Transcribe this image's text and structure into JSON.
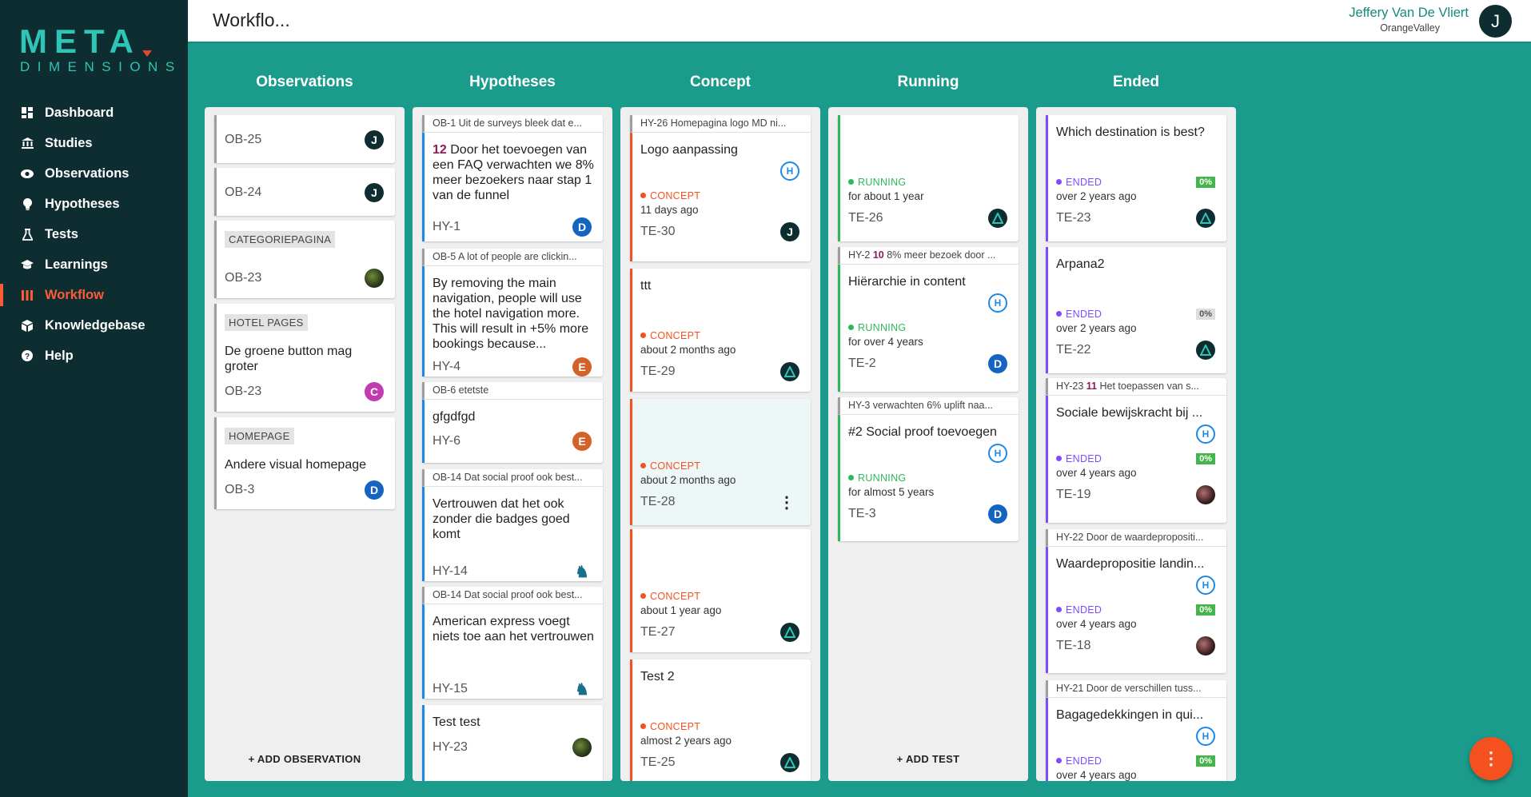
{
  "brand": {
    "name": "META",
    "sub": "DIMENSIONS"
  },
  "nav": [
    {
      "label": "Dashboard",
      "icon": "dashboard-icon"
    },
    {
      "label": "Studies",
      "icon": "bank-icon"
    },
    {
      "label": "Observations",
      "icon": "eye-icon"
    },
    {
      "label": "Hypotheses",
      "icon": "lightbulb-icon"
    },
    {
      "label": "Tests",
      "icon": "flask-icon"
    },
    {
      "label": "Learnings",
      "icon": "graduation-cap-icon"
    },
    {
      "label": "Workflow",
      "icon": "columns-icon",
      "active": true
    },
    {
      "label": "Knowledgebase",
      "icon": "box-icon"
    },
    {
      "label": "Help",
      "icon": "help-circle-icon"
    }
  ],
  "header": {
    "title": "Workflo...",
    "user_name": "Jeffery Van De Vliert",
    "user_org": "OrangeValley",
    "user_initial": "J"
  },
  "columns": {
    "observations": {
      "title": "Observations",
      "add_label": "+ ADD OBSERVATION"
    },
    "hypotheses": {
      "title": "Hypotheses"
    },
    "concept": {
      "title": "Concept"
    },
    "running": {
      "title": "Running",
      "add_label": "+ ADD TEST"
    },
    "ended": {
      "title": "Ended"
    }
  },
  "observations": [
    {
      "id": "OB-25",
      "avatar": "J"
    },
    {
      "id": "OB-24",
      "avatar": "J"
    },
    {
      "tag": "CATEGORIEPAGINA",
      "id": "OB-23"
    },
    {
      "tag": "HOTEL PAGES",
      "title": "De groene button mag groter",
      "id": "OB-23",
      "avatar": "C"
    },
    {
      "tag": "HOMEPAGE",
      "title": "Andere visual homepage",
      "id": "OB-3",
      "avatar": "D"
    }
  ],
  "hypotheses": [
    {
      "header": "OB-1 Uit de surveys bleek dat e...",
      "score": "12",
      "title": "Door het toevoegen van een FAQ verwachten we 8% meer bezoekers naar stap 1 van de funnel",
      "id": "HY-1",
      "avatar": "D"
    },
    {
      "header": "OB-5 A lot of people are clickin...",
      "title": "By removing the main navigation, people will use the hotel navigation more. This will result in +5% more bookings because...",
      "id": "HY-4",
      "avatar": "E"
    },
    {
      "header": "OB-6 etetste",
      "title": "gfgdfgd",
      "id": "HY-6",
      "avatar": "E"
    },
    {
      "header": "OB-14 Dat social proof ook best...",
      "title": "Vertrouwen dat het ook zonder die badges goed komt",
      "id": "HY-14"
    },
    {
      "header": "OB-14 Dat social proof ook best...",
      "title": "American express voegt niets toe aan het vertrouwen",
      "id": "HY-15"
    },
    {
      "title": "Test test",
      "id": "HY-23"
    }
  ],
  "concept": [
    {
      "header": "HY-26 Homepagina logo MD ni...",
      "title": "Logo aanpassing",
      "hbadge": "H",
      "status": "CONCEPT",
      "time": "11 days ago",
      "id": "TE-30",
      "avatar": "J"
    },
    {
      "title": "ttt",
      "status": "CONCEPT",
      "time": "about 2 months ago",
      "id": "TE-29"
    },
    {
      "status": "CONCEPT",
      "time": "about 2 months ago",
      "id": "TE-28",
      "menu": "⋮"
    },
    {
      "status": "CONCEPT",
      "time": "about 1 year ago",
      "id": "TE-27"
    },
    {
      "title": "Test 2",
      "status": "CONCEPT",
      "time": "almost 2 years ago",
      "id": "TE-25"
    }
  ],
  "running": [
    {
      "status": "RUNNING",
      "time": "for about 1 year",
      "id": "TE-26"
    },
    {
      "header_id": "HY-2",
      "header_score": "10",
      "header_text": "8% meer bezoek door ...",
      "title": "Hiërarchie in content",
      "hbadge": "H",
      "status": "RUNNING",
      "time": "for over 4 years",
      "id": "TE-2",
      "avatar": "D"
    },
    {
      "header": "HY-3 verwachten 6% uplift naa...",
      "title": "#2 Social proof toevoegen",
      "hbadge": "H",
      "status": "RUNNING",
      "time": "for almost 5 years",
      "id": "TE-3",
      "avatar": "D"
    }
  ],
  "ended": [
    {
      "title": "Which destination is best?",
      "status": "ENDED",
      "pct": "0%",
      "time": "over 2 years ago",
      "id": "TE-23"
    },
    {
      "title": "Arpana2",
      "status": "ENDED",
      "pct": "0%",
      "time": "over 2 years ago",
      "id": "TE-22"
    },
    {
      "header_id": "HY-23",
      "header_score": "11",
      "header_text": "Het toepassen van s...",
      "title": "Sociale bewijskracht bij ...",
      "hbadge": "H",
      "status": "ENDED",
      "pct": "0%",
      "time": "over 4 years ago",
      "id": "TE-19"
    },
    {
      "header": "HY-22 Door de waardepropositi...",
      "title": "Waardepropositie landin...",
      "hbadge": "H",
      "status": "ENDED",
      "pct": "0%",
      "time": "over 4 years ago",
      "id": "TE-18"
    },
    {
      "header": "HY-21 Door de verschillen tuss...",
      "title": "Bagagedekkingen in qui...",
      "hbadge": "H",
      "status": "ENDED",
      "pct": "0%",
      "time": "over 4 years ago"
    }
  ],
  "colors": {
    "concept": "#f4511e",
    "running": "#2eb85c",
    "ended": "#7c4dff",
    "accent": "#ff5a36",
    "teal": "#1a9b8c"
  },
  "fab": {
    "label": "⋮"
  }
}
